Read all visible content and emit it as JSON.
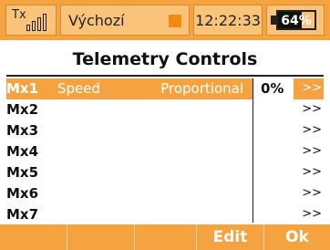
{
  "status_bar": {
    "tx_label": "Tx",
    "model_name": "Výchozí",
    "time": "12:22:33",
    "battery_text": "64%",
    "battery_level": 0.64,
    "accent_color": "#f4a340"
  },
  "title": "Telemetry Controls",
  "rows": [
    {
      "name": "Mx1",
      "sensor": "Speed",
      "mode": "Proportional",
      "value": "0%",
      "arrow": ">>"
    },
    {
      "name": "Mx2",
      "sensor": "",
      "mode": "",
      "value": "",
      "arrow": ">>"
    },
    {
      "name": "Mx3",
      "sensor": "",
      "mode": "",
      "value": "",
      "arrow": ">>"
    },
    {
      "name": "Mx4",
      "sensor": "",
      "mode": "",
      "value": "",
      "arrow": ">>"
    },
    {
      "name": "Mx5",
      "sensor": "",
      "mode": "",
      "value": "",
      "arrow": ">>"
    },
    {
      "name": "Mx6",
      "sensor": "",
      "mode": "",
      "value": "",
      "arrow": ">>"
    },
    {
      "name": "Mx7",
      "sensor": "",
      "mode": "",
      "value": "",
      "arrow": ">>"
    }
  ],
  "softkeys": [
    "",
    "",
    "",
    "Edit",
    "Ok"
  ]
}
